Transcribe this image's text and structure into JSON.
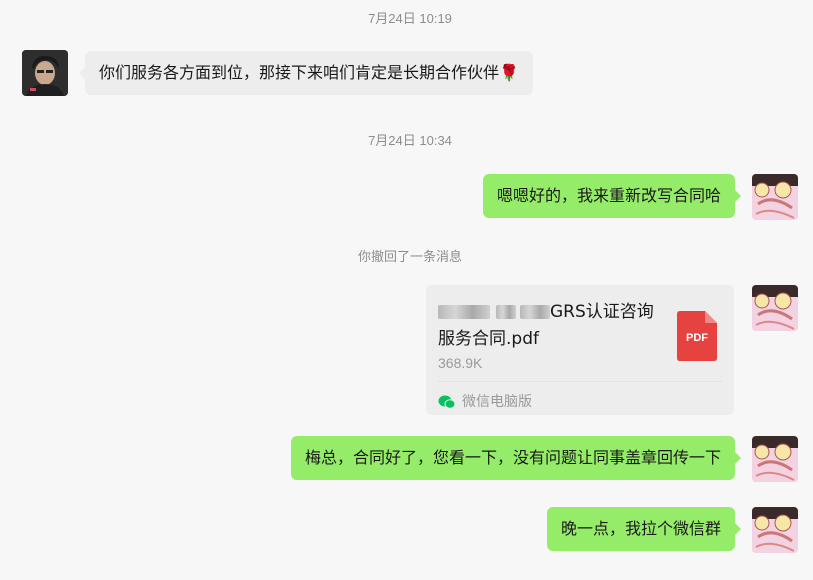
{
  "timestamps": [
    "7月24日 10:19",
    "7月24日 10:34"
  ],
  "messages": {
    "m1": "你们服务各方面到位，那接下来咱们肯定是长期合作伙伴🌹",
    "m2": "嗯嗯好的，我来重新改写合同哈",
    "recall_notice": "你撤回了一条消息",
    "m4": "梅总，合同好了，您看一下，没有问题让同事盖章回传一下",
    "m5": "晚一点，我拉个微信群"
  },
  "file": {
    "name_line1_visible": "GRS认证咨询",
    "name_line2": "服务合同.pdf",
    "size": "368.9K",
    "type_label": "PDF",
    "source": "微信电脑版"
  },
  "colors": {
    "self_bubble": "#95ec69",
    "other_bubble": "#ededed",
    "pdf_red": "#e64340",
    "background": "#f7f7f8"
  },
  "icons": {
    "pdf": "pdf-file-icon",
    "source": "wechat-logo-icon",
    "rose": "rose-emoji"
  }
}
